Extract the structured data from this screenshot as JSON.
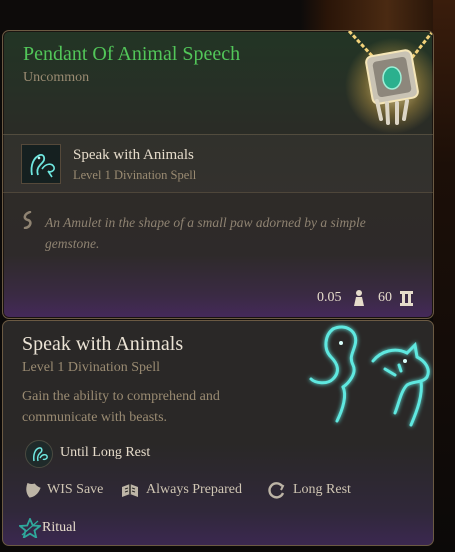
{
  "item": {
    "name": "Pendant Of Animal Speech",
    "rarity": "Uncommon",
    "icon": "pendant-icon",
    "granted_spell": {
      "name": "Speak with Animals",
      "subtitle": "Level 1 Divination Spell",
      "icon": "animal-spirit-icon"
    },
    "description": "An Amulet in the shape of a small paw adorned by a simple gemstone.",
    "weight": "0.05",
    "value": "60",
    "colors": {
      "rarity": "#52c659",
      "frame": "#6b5a43"
    }
  },
  "spell": {
    "name": "Speak with Animals",
    "subtitle": "Level 1 Divination Spell",
    "description": "Gain the ability to comprehend and communicate with beasts.",
    "duration": "Until Long Rest",
    "tags": [
      {
        "label": "WIS Save",
        "icon": "shield-icon"
      },
      {
        "label": "Always Prepared",
        "icon": "prepared-book-icon"
      },
      {
        "label": "Long Rest",
        "icon": "long-rest-icon"
      }
    ],
    "ritual": "Ritual",
    "colors": {
      "glow": "#5fe8e0",
      "ritual": "#2fa89c"
    }
  }
}
